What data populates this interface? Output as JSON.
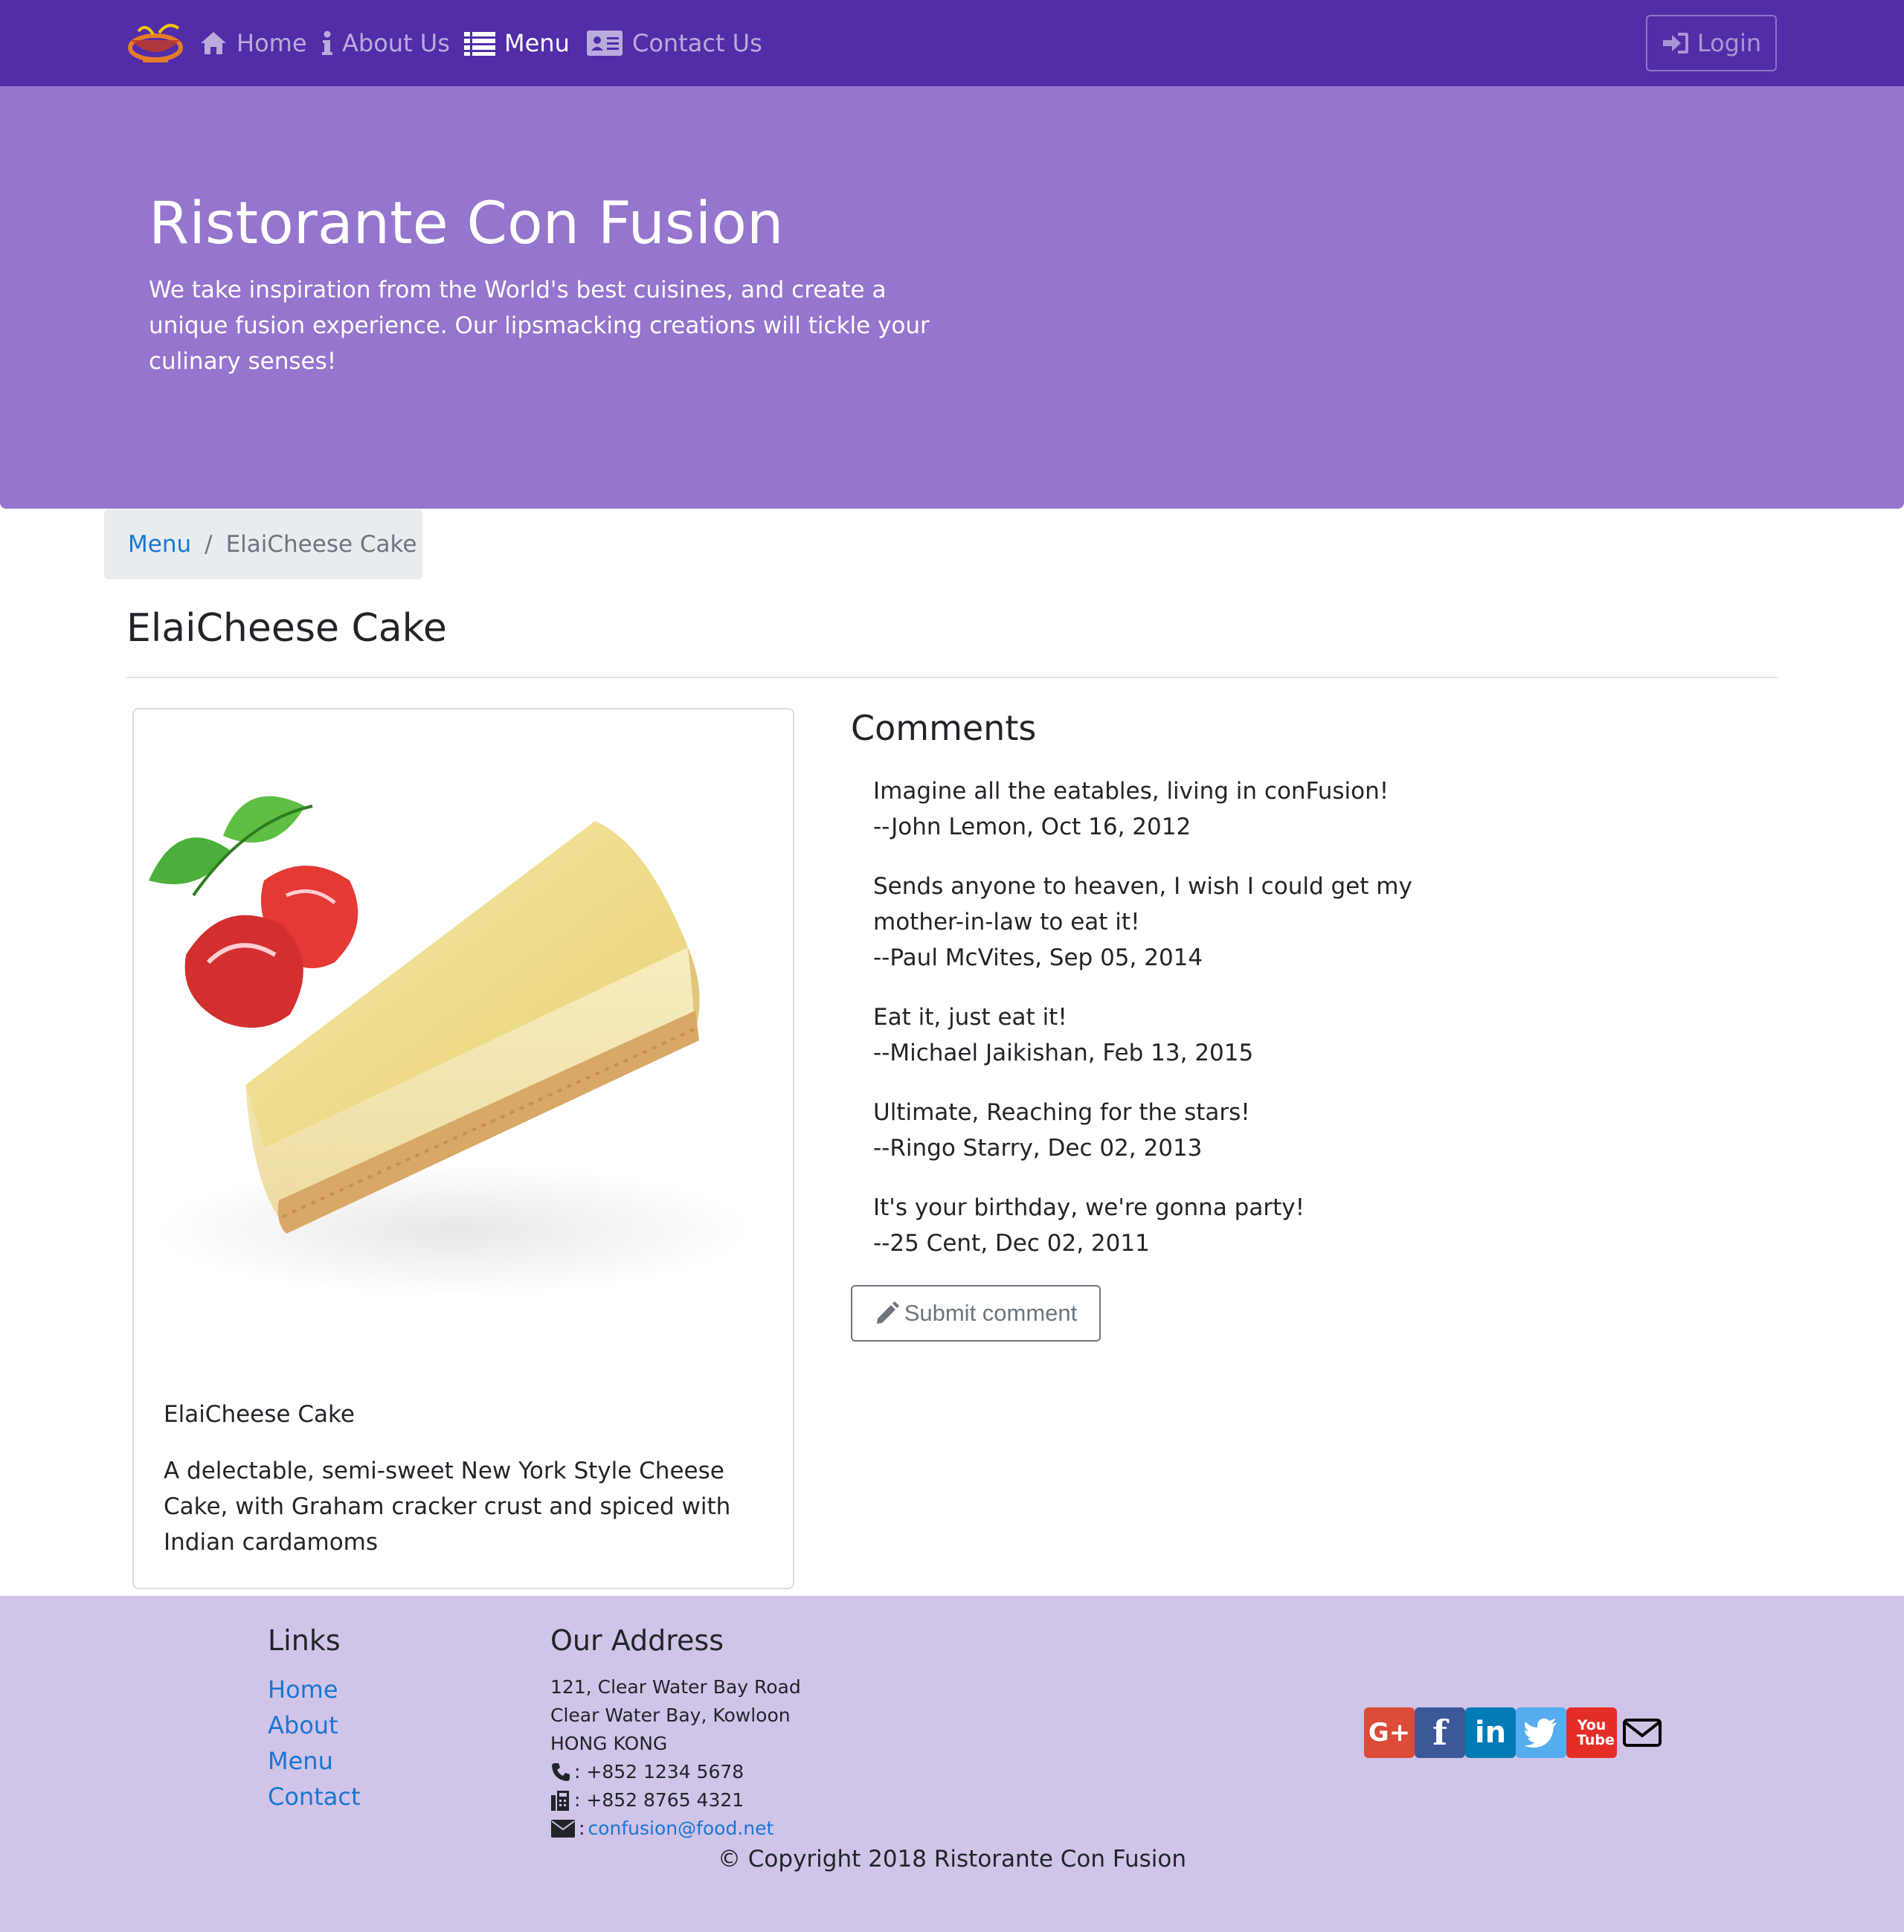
{
  "nav": {
    "items": [
      {
        "label": "Home",
        "icon": "home-icon"
      },
      {
        "label": "About Us",
        "icon": "info-icon"
      },
      {
        "label": "Menu",
        "icon": "list-icon"
      },
      {
        "label": "Contact Us",
        "icon": "address-card-icon"
      }
    ],
    "active": "Menu",
    "login_label": "Login"
  },
  "jumbotron": {
    "title": "Ristorante Con Fusion",
    "text": "We take inspiration from the World's best cuisines, and create a unique fusion experience. Our lipsmacking creations will tickle your culinary senses!"
  },
  "breadcrumb": {
    "link": "Menu",
    "active": "ElaiCheese Cake"
  },
  "dish": {
    "title": "ElaiCheese Cake",
    "name": "ElaiCheese Cake",
    "description": "A delectable, semi-sweet New York Style Cheese Cake, with Graham cracker crust and spiced with Indian cardamoms"
  },
  "comments": {
    "title": "Comments",
    "items": [
      {
        "text": "Imagine all the eatables, living in conFusion!",
        "byline": "--John Lemon, Oct 16, 2012"
      },
      {
        "text": "Sends anyone to heaven, I wish I could get my mother-in-law to eat it!",
        "byline": "--Paul McVites, Sep 05, 2014"
      },
      {
        "text": "Eat it, just eat it!",
        "byline": "--Michael Jaikishan, Feb 13, 2015"
      },
      {
        "text": "Ultimate, Reaching for the stars!",
        "byline": "--Ringo Starry, Dec 02, 2013"
      },
      {
        "text": "It's your birthday, we're gonna party!",
        "byline": "--25 Cent, Dec 02, 2011"
      }
    ],
    "submit_label": "Submit comment"
  },
  "footer": {
    "links_title": "Links",
    "links": [
      "Home",
      "About",
      "Menu",
      "Contact"
    ],
    "address_title": "Our Address",
    "address_lines": [
      "121, Clear Water Bay Road",
      "Clear Water Bay, Kowloon",
      "HONG KONG"
    ],
    "phone": ": +852 1234 5678",
    "fax": ": +852 8765 4321",
    "email": "confusion@food.net",
    "email_prefix": ":",
    "social": [
      {
        "name": "google-plus-icon",
        "label": "G+",
        "color": "#dd4b39"
      },
      {
        "name": "facebook-icon",
        "label": "f",
        "color": "#3b5998"
      },
      {
        "name": "linkedin-icon",
        "label": "in",
        "color": "#007bb6"
      },
      {
        "name": "twitter-icon",
        "label": "",
        "color": "#55acee"
      },
      {
        "name": "youtube-icon",
        "label": "You Tube",
        "color": "#e52d27"
      },
      {
        "name": "envelope-icon",
        "label": "",
        "color": "#000000"
      }
    ],
    "copyright": "© Copyright 2018 Ristorante Con Fusion"
  }
}
